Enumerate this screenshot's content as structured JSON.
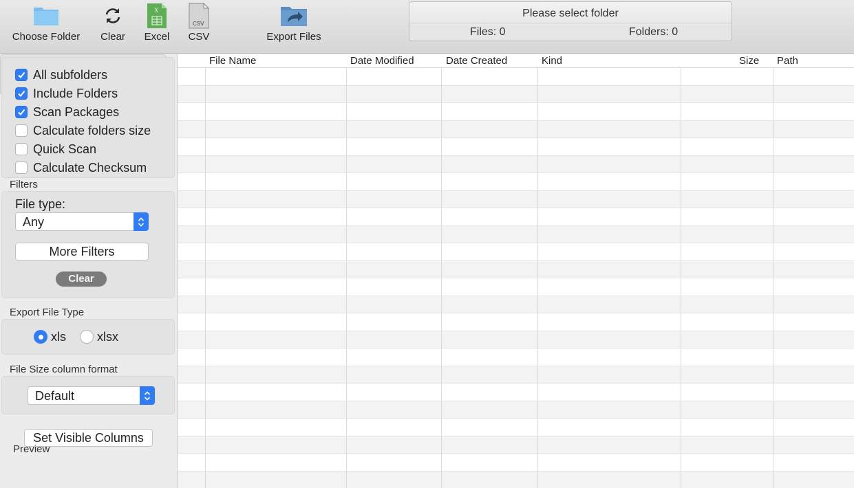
{
  "toolbar": {
    "choose_folder": {
      "label": "Choose Folder",
      "icon": "folder-icon"
    },
    "clear": {
      "label": "Clear",
      "icon": "refresh-icon"
    },
    "excel": {
      "label": "Excel",
      "icon": "excel-file-icon"
    },
    "csv": {
      "label": "CSV",
      "icon": "csv-file-icon",
      "icon_text": "CSV"
    },
    "export_files": {
      "label": "Export Files",
      "icon": "export-folder-icon"
    }
  },
  "status": {
    "message": "Please select folder",
    "files": "Files: 0",
    "folders": "Folders: 0"
  },
  "options": [
    {
      "label": "All subfolders",
      "checked": true
    },
    {
      "label": "Include Folders",
      "checked": true
    },
    {
      "label": "Scan Packages",
      "checked": true
    },
    {
      "label": "Calculate folders size",
      "checked": false
    },
    {
      "label": "Quick Scan",
      "checked": false
    },
    {
      "label": "Calculate Checksum",
      "checked": false
    }
  ],
  "filters": {
    "title": "Filters",
    "file_type_label": "File type:",
    "file_type_value": "Any",
    "more_filters": "More Filters",
    "clear": "Clear"
  },
  "export_type": {
    "title": "Export File Type",
    "options": [
      {
        "label": "xls",
        "selected": true
      },
      {
        "label": "xlsx",
        "selected": false
      }
    ]
  },
  "size_format": {
    "title": "File Size column format",
    "value": "Default"
  },
  "set_visible_columns": "Set Visible Columns",
  "preview_title": "Preview",
  "table": {
    "columns": [
      "File Name",
      "Date Modified",
      "Date Created",
      "Kind",
      "Size",
      "Path"
    ]
  },
  "colors": {
    "accent": "#2f7cf6",
    "clear_pill": "#7b7b7b",
    "excel_green": "#5fae57"
  }
}
